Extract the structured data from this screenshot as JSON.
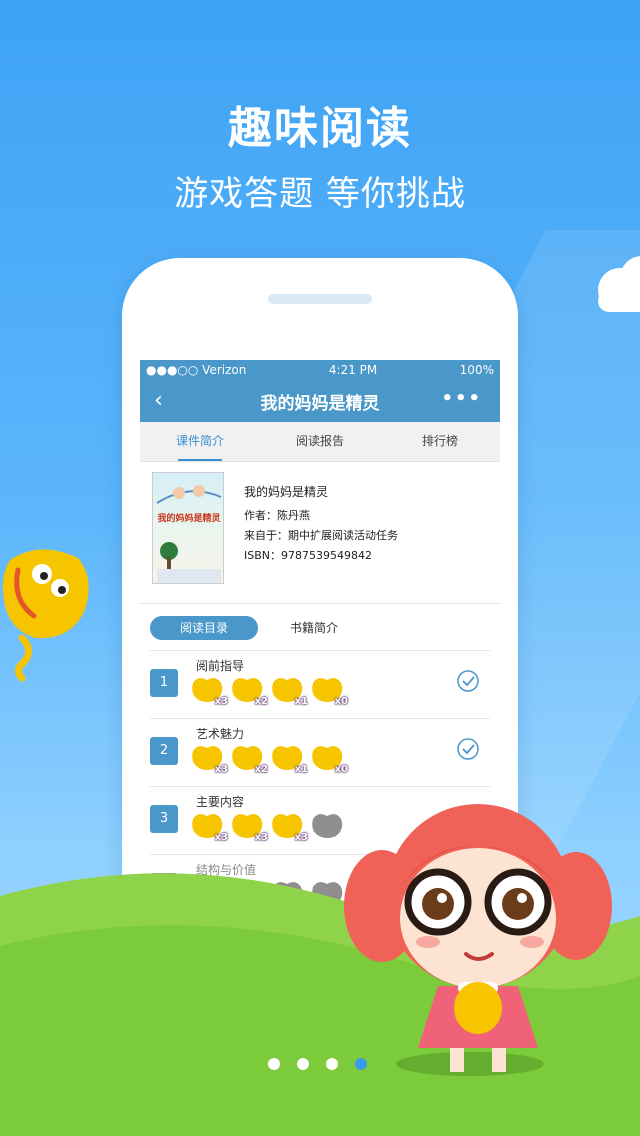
{
  "headline": "趣味阅读",
  "subline": "游戏答题 等你挑战",
  "status": {
    "carrier": "●●●○○ Verizon",
    "time": "4:21 PM",
    "battery": "100%"
  },
  "nav": {
    "title": "我的妈妈是精灵"
  },
  "tabs": [
    "课件简介",
    "阅读报告",
    "排行榜"
  ],
  "book": {
    "name": "我的妈妈是精灵",
    "author": "作者：陈丹燕",
    "source": "来自于：期中扩展阅读活动任务",
    "isbn": "ISBN：9787539549842",
    "cover_title": "我的妈妈是精灵"
  },
  "subtabs": {
    "active": "阅读目录",
    "other": "书籍简介"
  },
  "chapters": [
    {
      "num": "1",
      "title": "阅前指导",
      "beans": [
        "x3",
        "x2",
        "x1",
        "x0"
      ],
      "done": true
    },
    {
      "num": "2",
      "title": "艺术魅力",
      "beans": [
        "x3",
        "x2",
        "x1",
        "x0"
      ],
      "done": true
    },
    {
      "num": "3",
      "title": "主要内容",
      "beans": [
        "x3",
        "x3",
        "x3",
        ""
      ],
      "done": false
    },
    {
      "num": "4",
      "title": "结构与价值",
      "beans": [
        "",
        "",
        "",
        ""
      ],
      "done": false
    }
  ],
  "pager": {
    "count": 4,
    "active_index": 3
  },
  "colors": {
    "accent": "#4a97c9",
    "bean": "#f7c400",
    "hill": "#7ccb3a"
  }
}
